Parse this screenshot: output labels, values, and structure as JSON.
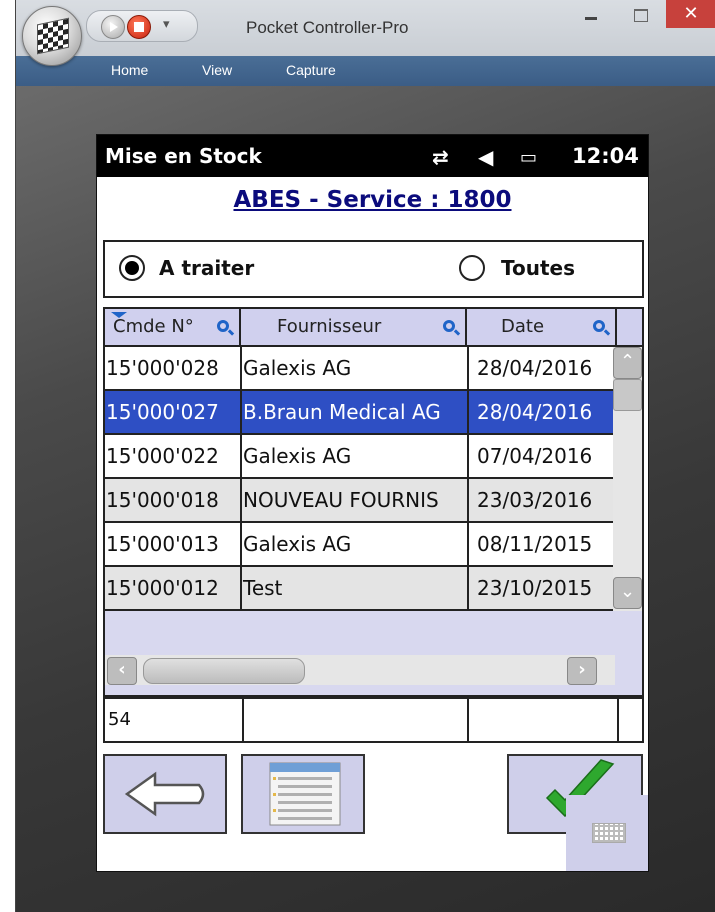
{
  "window": {
    "title": "Pocket Controller-Pro",
    "close_glyph": "✕"
  },
  "menu": {
    "items": [
      "Home",
      "View",
      "Capture"
    ]
  },
  "device": {
    "status_title": "Mise en Stock",
    "time": "12:04",
    "heading": "ABES - Service : 1800",
    "radios": {
      "option1": "A traiter",
      "option2": "Toutes",
      "selected": "A traiter"
    },
    "grid": {
      "headers": [
        "Cmde N°",
        "Fournisseur",
        "Date"
      ],
      "rows": [
        {
          "cmde": "15'000'028",
          "fournisseur": "Galexis AG",
          "date": "28/04/2016"
        },
        {
          "cmde": "15'000'027",
          "fournisseur": "B.Braun Medical AG",
          "date": "28/04/2016"
        },
        {
          "cmde": "15'000'022",
          "fournisseur": "Galexis AG",
          "date": "07/04/2016"
        },
        {
          "cmde": "15'000'018",
          "fournisseur": "NOUVEAU FOURNIS",
          "date": "23/03/2016"
        },
        {
          "cmde": "15'000'013",
          "fournisseur": "Galexis AG",
          "date": "08/11/2015"
        },
        {
          "cmde": "15'000'012",
          "fournisseur": "Test",
          "date": "23/10/2015"
        }
      ],
      "selected_row": 1,
      "footer_count": "54"
    },
    "colors": {
      "selection": "#2e4fc4",
      "heading": "#0b0b7c",
      "button_bg": "#cfcfea",
      "check": "#2ea82e"
    },
    "icons": [
      "back-arrow-icon",
      "list-icon",
      "checkmark-icon",
      "keyboard-icon"
    ]
  }
}
